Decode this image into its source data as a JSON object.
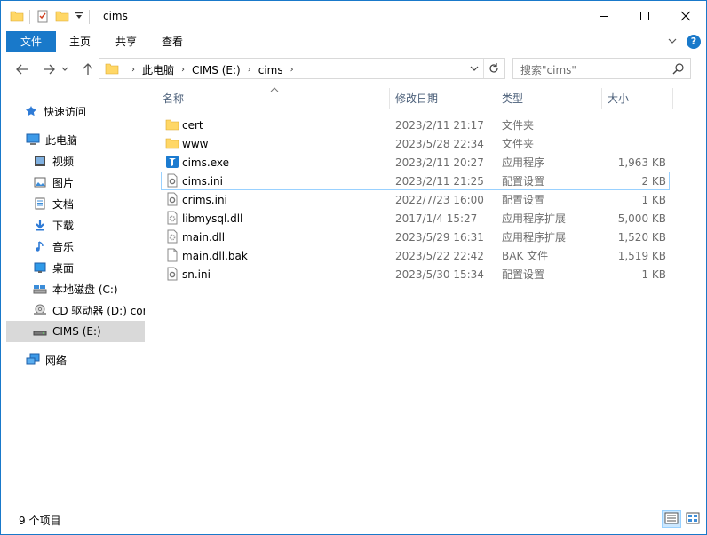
{
  "window": {
    "title": "cims",
    "accent": "#1979ca"
  },
  "ribbon": {
    "tabs": [
      "文件",
      "主页",
      "共享",
      "查看"
    ]
  },
  "address": {
    "crumbs": [
      "此电脑",
      "CIMS (E:)",
      "cims"
    ]
  },
  "search": {
    "placeholder": "搜索\"cims\""
  },
  "nav": {
    "items": [
      {
        "label": "快速访问",
        "icon": "star-icon"
      },
      {
        "label": "此电脑",
        "icon": "computer-icon"
      },
      {
        "label": "视频",
        "icon": "video-icon"
      },
      {
        "label": "图片",
        "icon": "pictures-icon"
      },
      {
        "label": "文档",
        "icon": "documents-icon"
      },
      {
        "label": "下载",
        "icon": "download-icon"
      },
      {
        "label": "音乐",
        "icon": "music-icon"
      },
      {
        "label": "桌面",
        "icon": "desktop-icon"
      },
      {
        "label": "本地磁盘 (C:)",
        "icon": "local-disk-icon"
      },
      {
        "label": "CD 驱动器 (D:) cor",
        "icon": "cd-drive-icon"
      },
      {
        "label": "CIMS (E:)",
        "icon": "drive-icon"
      },
      {
        "label": "网络",
        "icon": "network-icon"
      }
    ]
  },
  "columns": {
    "name": "名称",
    "date": "修改日期",
    "type": "类型",
    "size": "大小"
  },
  "files": [
    {
      "name": "cert",
      "date": "2023/2/11 21:17",
      "type": "文件夹",
      "size": "",
      "icon": "folder-icon"
    },
    {
      "name": "www",
      "date": "2023/5/28 22:34",
      "type": "文件夹",
      "size": "",
      "icon": "folder-icon"
    },
    {
      "name": "cims.exe",
      "date": "2023/2/11 20:27",
      "type": "应用程序",
      "size": "1,963 KB",
      "icon": "exe-icon"
    },
    {
      "name": "cims.ini",
      "date": "2023/2/11 21:25",
      "type": "配置设置",
      "size": "2 KB",
      "icon": "ini-icon"
    },
    {
      "name": "crims.ini",
      "date": "2022/7/23 16:00",
      "type": "配置设置",
      "size": "1 KB",
      "icon": "ini-icon"
    },
    {
      "name": "libmysql.dll",
      "date": "2017/1/4 15:27",
      "type": "应用程序扩展",
      "size": "5,000 KB",
      "icon": "dll-icon"
    },
    {
      "name": "main.dll",
      "date": "2023/5/29 16:31",
      "type": "应用程序扩展",
      "size": "1,520 KB",
      "icon": "dll-icon"
    },
    {
      "name": "main.dll.bak",
      "date": "2023/5/22 22:42",
      "type": "BAK 文件",
      "size": "1,519 KB",
      "icon": "file-icon"
    },
    {
      "name": "sn.ini",
      "date": "2023/5/30 15:34",
      "type": "配置设置",
      "size": "1 KB",
      "icon": "ini-icon"
    }
  ],
  "status": {
    "count": "9 个项目"
  }
}
